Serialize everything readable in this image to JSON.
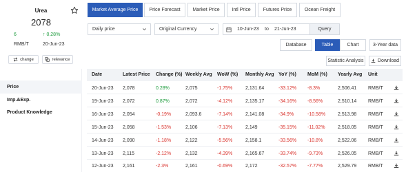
{
  "product": {
    "name": "Urea",
    "price": "2078",
    "change_abs": "6",
    "change_pct": "0.28%",
    "unit": "RMB/T",
    "date": "20-Jun-23",
    "change_btn": "change",
    "relevance_btn": "relevance"
  },
  "sidebar": {
    "items": [
      {
        "label": "Price"
      },
      {
        "label": "Imp.&Exp."
      },
      {
        "label": "Product Knowledge"
      }
    ]
  },
  "tabs": [
    {
      "label": "Market Average Price"
    },
    {
      "label": "Price Forecast"
    },
    {
      "label": "Market Price"
    },
    {
      "label": "Intl Price"
    },
    {
      "label": "Futures Price"
    },
    {
      "label": "Ocean Freight"
    }
  ],
  "filters": {
    "price_type": "Daily price",
    "currency": "Original Currency",
    "date_from": "10-Jun-23",
    "date_to_word": "to",
    "date_to": "21-Jun-23",
    "query": "Query"
  },
  "views": {
    "database": "Database",
    "table": "Table",
    "chart": "Chart",
    "three_year": "3-Year data"
  },
  "actions": {
    "statistic": "Statistic Analysis",
    "download": "Download"
  },
  "table": {
    "headers": [
      "Date",
      "Latest Price",
      "Change (%)",
      "Weekly Avg",
      "WoW (%)",
      "Monthly Avg",
      "YoY (%)",
      "MoM (%)",
      "Yearly Avg",
      "Unit"
    ],
    "rows": [
      [
        "20-Jun-23",
        "2,078",
        "0.28%",
        "2,075",
        "-1.75%",
        "2,131.64",
        "-33.12%",
        "-8.3%",
        "2,506.41",
        "RMB/T"
      ],
      [
        "19-Jun-23",
        "2,072",
        "0.87%",
        "2,072",
        "-4.12%",
        "2,135.17",
        "-34.16%",
        "-8.56%",
        "2,510.14",
        "RMB/T"
      ],
      [
        "16-Jun-23",
        "2,054",
        "-0.19%",
        "2,093.6",
        "-7.14%",
        "2,141.08",
        "-34.9%",
        "-10.58%",
        "2,513.98",
        "RMB/T"
      ],
      [
        "15-Jun-23",
        "2,058",
        "-1.53%",
        "2,106",
        "-7.13%",
        "2,149",
        "-35.15%",
        "-11.02%",
        "2,518.05",
        "RMB/T"
      ],
      [
        "14-Jun-23",
        "2,090",
        "-1.18%",
        "2,122",
        "-5.56%",
        "2,158.1",
        "-33.56%",
        "-10.8%",
        "2,522.06",
        "RMB/T"
      ],
      [
        "13-Jun-23",
        "2,115",
        "-2.12%",
        "2,132",
        "-4.39%",
        "2,165.67",
        "-33.74%",
        "-9.73%",
        "2,526.05",
        "RMB/T"
      ],
      [
        "12-Jun-23",
        "2,161",
        "-2.3%",
        "2,161",
        "-0.69%",
        "2,172",
        "-32.57%",
        "-7.77%",
        "2,529.79",
        "RMB/T"
      ]
    ]
  }
}
